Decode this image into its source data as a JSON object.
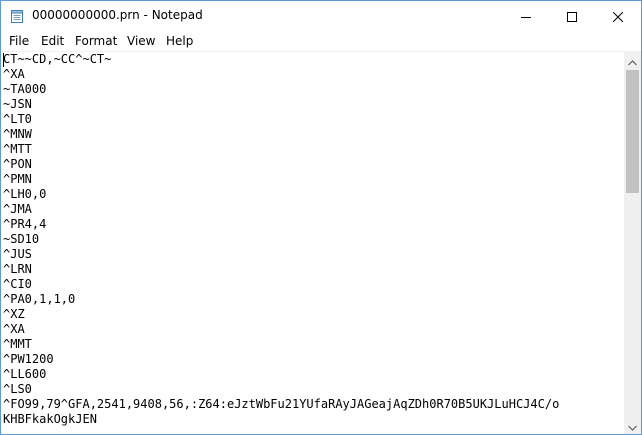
{
  "window": {
    "title": "00000000000.prn - Notepad"
  },
  "icons": {
    "app": "notepad-icon",
    "minimize": "minimize-icon",
    "maximize": "maximize-icon",
    "close": "close-icon",
    "scroll_up": "chevron-up-icon",
    "scroll_down": "chevron-down-icon"
  },
  "menu": {
    "file": "File",
    "edit": "Edit",
    "format": "Format",
    "view": "View",
    "help": "Help"
  },
  "editor": {
    "lines": [
      "CT~~CD,~CC^~CT~",
      "^XA",
      "~TA000",
      "~JSN",
      "^LT0",
      "^MNW",
      "^MTT",
      "^PON",
      "^PMN",
      "^LH0,0",
      "^JMA",
      "^PR4,4",
      "~SD10",
      "^JUS",
      "^LRN",
      "^CI0",
      "^PA0,1,1,0",
      "^XZ",
      "^XA",
      "^MMT",
      "^PW1200",
      "^LL600",
      "^LS0",
      "^FO99,79^GFA,2541,9408,56,:Z64:eJztWbFu21YUfaRAyJAGeajAqZDh0R70B5UKJLuHCJ4C/o",
      "KHBFkakOgkJEN"
    ]
  },
  "colors": {
    "window_border": "#5f9ad8",
    "scrollbar_track": "#f0f0f0",
    "scrollbar_thumb": "#c1c1c1"
  }
}
